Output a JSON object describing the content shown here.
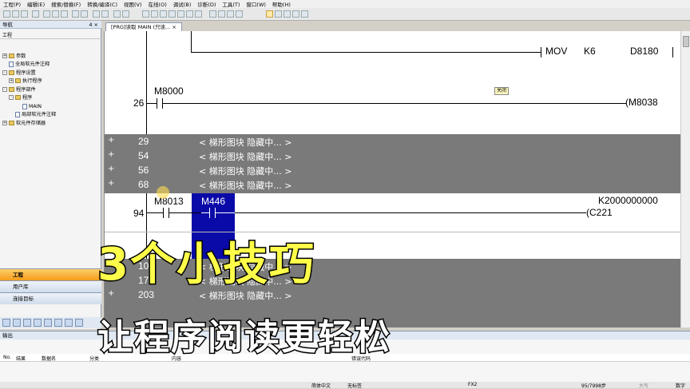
{
  "menubar": [
    "工程(P)",
    "编辑(E)",
    "搜索/替换(F)",
    "转换/编译(C)",
    "视图(V)",
    "在线(O)",
    "调试(B)",
    "诊断(D)",
    "工具(T)",
    "窗口(W)",
    "帮助(H)"
  ],
  "nav": {
    "title": "导航",
    "pin": "4 ×",
    "section": "工程",
    "tree": [
      "参数",
      "全局软元件注释",
      "程序设置",
      "执行程序",
      "程序部件",
      "程序",
      "MAIN",
      "局部软元件注释",
      "软元件存储器"
    ],
    "buttons": {
      "project": "工程",
      "library": "用户库",
      "connection": "连接目标"
    }
  },
  "tab": {
    "label": "[PRG]读取 MAIN (只读..."
  },
  "ladder": {
    "mov": {
      "instr": "MOV",
      "src": "K6",
      "dst": "D8180"
    },
    "rung26": {
      "step": "26",
      "contact": "M8000",
      "coil": "M8038",
      "chip": "关闭"
    },
    "hidden1": [
      {
        "plus": "+",
        "step": "29",
        "text": "< 梯形图块 隐藏中... >"
      },
      {
        "plus": "+",
        "step": "54",
        "text": "< 梯形图块 隐藏中... >"
      },
      {
        "plus": "+",
        "step": "56",
        "text": "< 梯形图块 隐藏中... >"
      },
      {
        "plus": "+",
        "step": "68",
        "text": "< 梯形图块 隐藏中... >"
      }
    ],
    "rung94": {
      "step": "94",
      "contact1": "M8013",
      "contact2": "M446",
      "setval": "K2000000000",
      "coil": "C221"
    },
    "hidden2": [
      {
        "plus": "+",
        "step": "103",
        "text": "< 梯形图块 隐藏中... >"
      },
      {
        "plus": "+",
        "step": "175",
        "text": "< 梯形图块 隐藏中... >"
      },
      {
        "plus": "+",
        "step": "203",
        "text": "< 梯形图块 隐藏中... >"
      }
    ]
  },
  "output": {
    "title": "输出",
    "columns": [
      "No.",
      "结果",
      "数据名",
      "分类",
      "内容",
      "错误代码"
    ]
  },
  "statusbar": {
    "lang": "简体中文",
    "label": "无标签",
    "plc": "FX2",
    "steps": "95/7998步",
    "mode": "大写",
    "num": "数字"
  },
  "caption": {
    "line1": "3个小技巧",
    "line2": "让程序阅读更轻松"
  },
  "colors": {
    "selection": "#0a0aa8",
    "hidden_row": "#7a7a7a",
    "caption_main": "#ffff4a"
  }
}
